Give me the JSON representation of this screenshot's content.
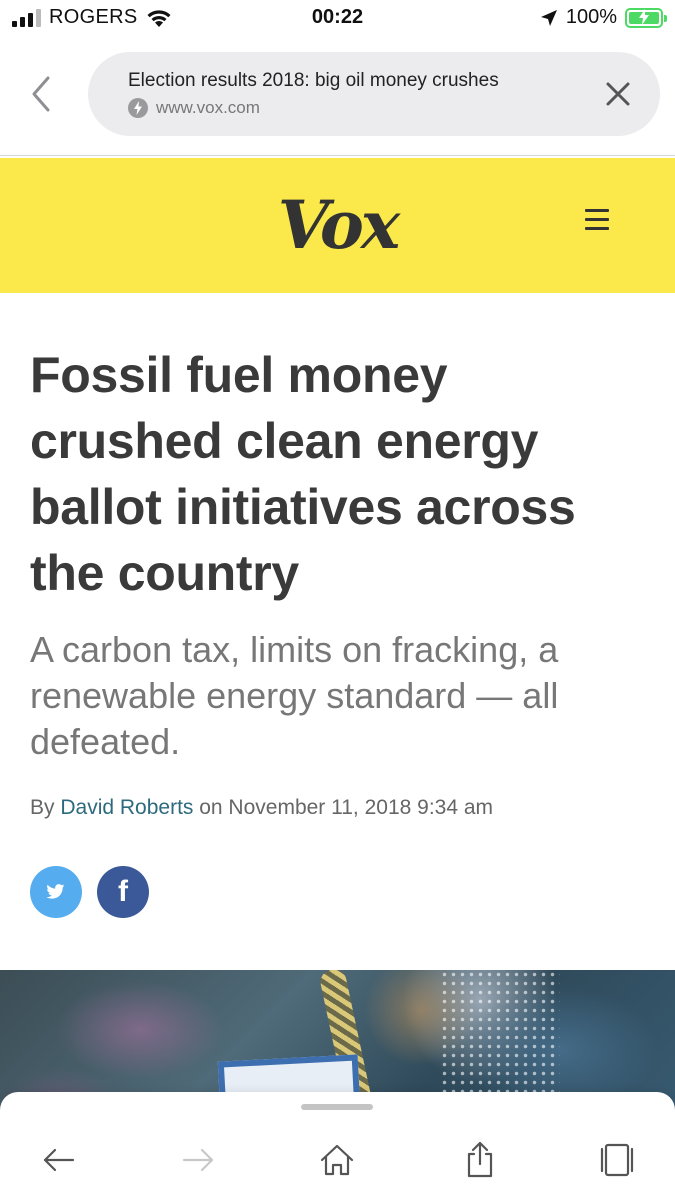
{
  "status_bar": {
    "carrier": "ROGERS",
    "time": "00:22",
    "battery_percent": "100%"
  },
  "browser": {
    "page_title": "Election results 2018: big oil money crushes",
    "domain": "www.vox.com"
  },
  "site": {
    "logo_text": "Vox",
    "brand_color": "#fbe94b"
  },
  "article": {
    "headline": "Fossil fuel money crushed clean energy ballot initiatives across the country",
    "dek": "A carbon tax, limits on fracking, a renewable energy standard — all defeated.",
    "byline_prefix": "By ",
    "author": "David Roberts",
    "byline_date": " on November 11, 2018 9:34 am"
  },
  "share": {
    "twitter_color": "#55acee",
    "facebook_color": "#3b5998",
    "facebook_glyph": "f"
  },
  "icons": [
    "signal-icon",
    "wifi-icon",
    "location-arrow-icon",
    "battery-icon",
    "back-chevron-icon",
    "amp-bolt-icon",
    "close-icon",
    "hamburger-menu-icon",
    "twitter-icon",
    "facebook-icon",
    "toolbar-back-icon",
    "toolbar-forward-icon",
    "home-icon",
    "share-icon",
    "tabs-icon"
  ]
}
